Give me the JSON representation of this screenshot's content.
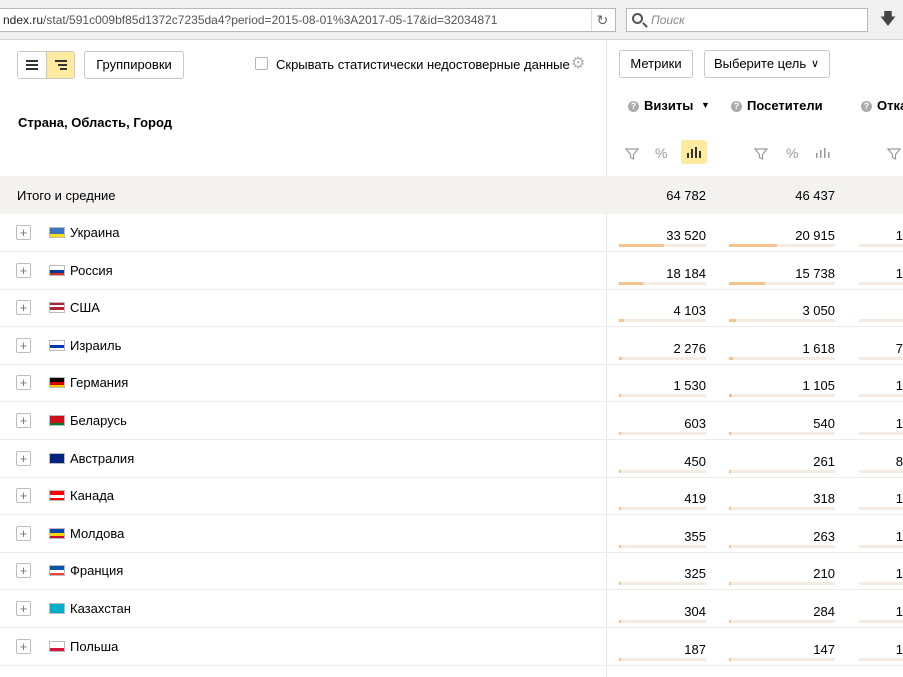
{
  "browser": {
    "url_host": "ndex.ru",
    "url_path": "/stat/591c009bf85d1372c7235da4?period=2015-08-01%3A2017-05-17&id=32034871",
    "search_placeholder": "Поиск"
  },
  "toolbar": {
    "groupings_label": "Группировки",
    "hide_unreliable_label": "Скрывать статистически недостоверные данные",
    "hide_unreliable_checked": false,
    "metrics_label": "Метрики",
    "goal_label": "Выберите цель"
  },
  "table": {
    "dimension_header": "Страна, Область, Город",
    "columns": [
      {
        "label": "Визиты",
        "sort": "▼"
      },
      {
        "label": "Посетители"
      },
      {
        "label": "Отка"
      }
    ],
    "col_controls": {
      "percent": "%"
    },
    "totals": {
      "label": "Итого и средние",
      "visits": "64 782",
      "visitors": "46 437"
    },
    "rows": [
      {
        "country": "Украина",
        "visits": "33 520",
        "visitors": "20 915",
        "third": "1",
        "visits_share": 0.517,
        "visitors_share": 0.45,
        "flag": [
          "#3a75c4",
          "#f9dd16"
        ]
      },
      {
        "country": "Россия",
        "visits": "18 184",
        "visitors": "15 738",
        "third": "1",
        "visits_share": 0.281,
        "visitors_share": 0.339,
        "flag": [
          "#ffffff",
          "#0039a6",
          "#d52b1e"
        ]
      },
      {
        "country": "США",
        "visits": "4 103",
        "visitors": "3 050",
        "third": "",
        "visits_share": 0.063,
        "visitors_share": 0.066,
        "flag": [
          "#b22234",
          "#ffffff",
          "#b22234",
          "#ffffff",
          "#3c3b6e"
        ]
      },
      {
        "country": "Израиль",
        "visits": "2 276",
        "visitors": "1 618",
        "third": "7",
        "visits_share": 0.035,
        "visitors_share": 0.035,
        "flag": [
          "#ffffff",
          "#0038b8",
          "#ffffff"
        ]
      },
      {
        "country": "Германия",
        "visits": "1 530",
        "visitors": "1 105",
        "third": "1",
        "visits_share": 0.024,
        "visitors_share": 0.024,
        "flag": [
          "#000000",
          "#dd0000",
          "#ffce00"
        ]
      },
      {
        "country": "Беларусь",
        "visits": "603",
        "visitors": "540",
        "third": "1",
        "visits_share": 0.009,
        "visitors_share": 0.012,
        "flag": [
          "#cf101a",
          "#cf101a",
          "#007d2c"
        ]
      },
      {
        "country": "Австралия",
        "visits": "450",
        "visitors": "261",
        "third": "8",
        "visits_share": 0.007,
        "visitors_share": 0.006,
        "flag": [
          "#00247d",
          "#00247d",
          "#00247d"
        ]
      },
      {
        "country": "Канада",
        "visits": "419",
        "visitors": "318",
        "third": "1",
        "visits_share": 0.006,
        "visitors_share": 0.007,
        "flag": [
          "#ff0000",
          "#ffffff",
          "#ff0000"
        ]
      },
      {
        "country": "Молдова",
        "visits": "355",
        "visitors": "263",
        "third": "1",
        "visits_share": 0.005,
        "visitors_share": 0.006,
        "flag": [
          "#0046ae",
          "#ffd200",
          "#cc092f"
        ]
      },
      {
        "country": "Франция",
        "visits": "325",
        "visitors": "210",
        "third": "1",
        "visits_share": 0.005,
        "visitors_share": 0.005,
        "flag": [
          "#0055a4",
          "#ffffff",
          "#ef4135"
        ]
      },
      {
        "country": "Казахстан",
        "visits": "304",
        "visitors": "284",
        "third": "1",
        "visits_share": 0.005,
        "visitors_share": 0.006,
        "flag": [
          "#00afca",
          "#00afca",
          "#00afca"
        ]
      },
      {
        "country": "Польша",
        "visits": "187",
        "visitors": "147",
        "third": "1",
        "visits_share": 0.003,
        "visitors_share": 0.003,
        "flag": [
          "#ffffff",
          "#dc143c"
        ]
      }
    ]
  },
  "colors": {
    "accent_yellow": "#ffeba0",
    "bar_fill": "#f4c38e",
    "bar_track": "#f4ece2"
  }
}
